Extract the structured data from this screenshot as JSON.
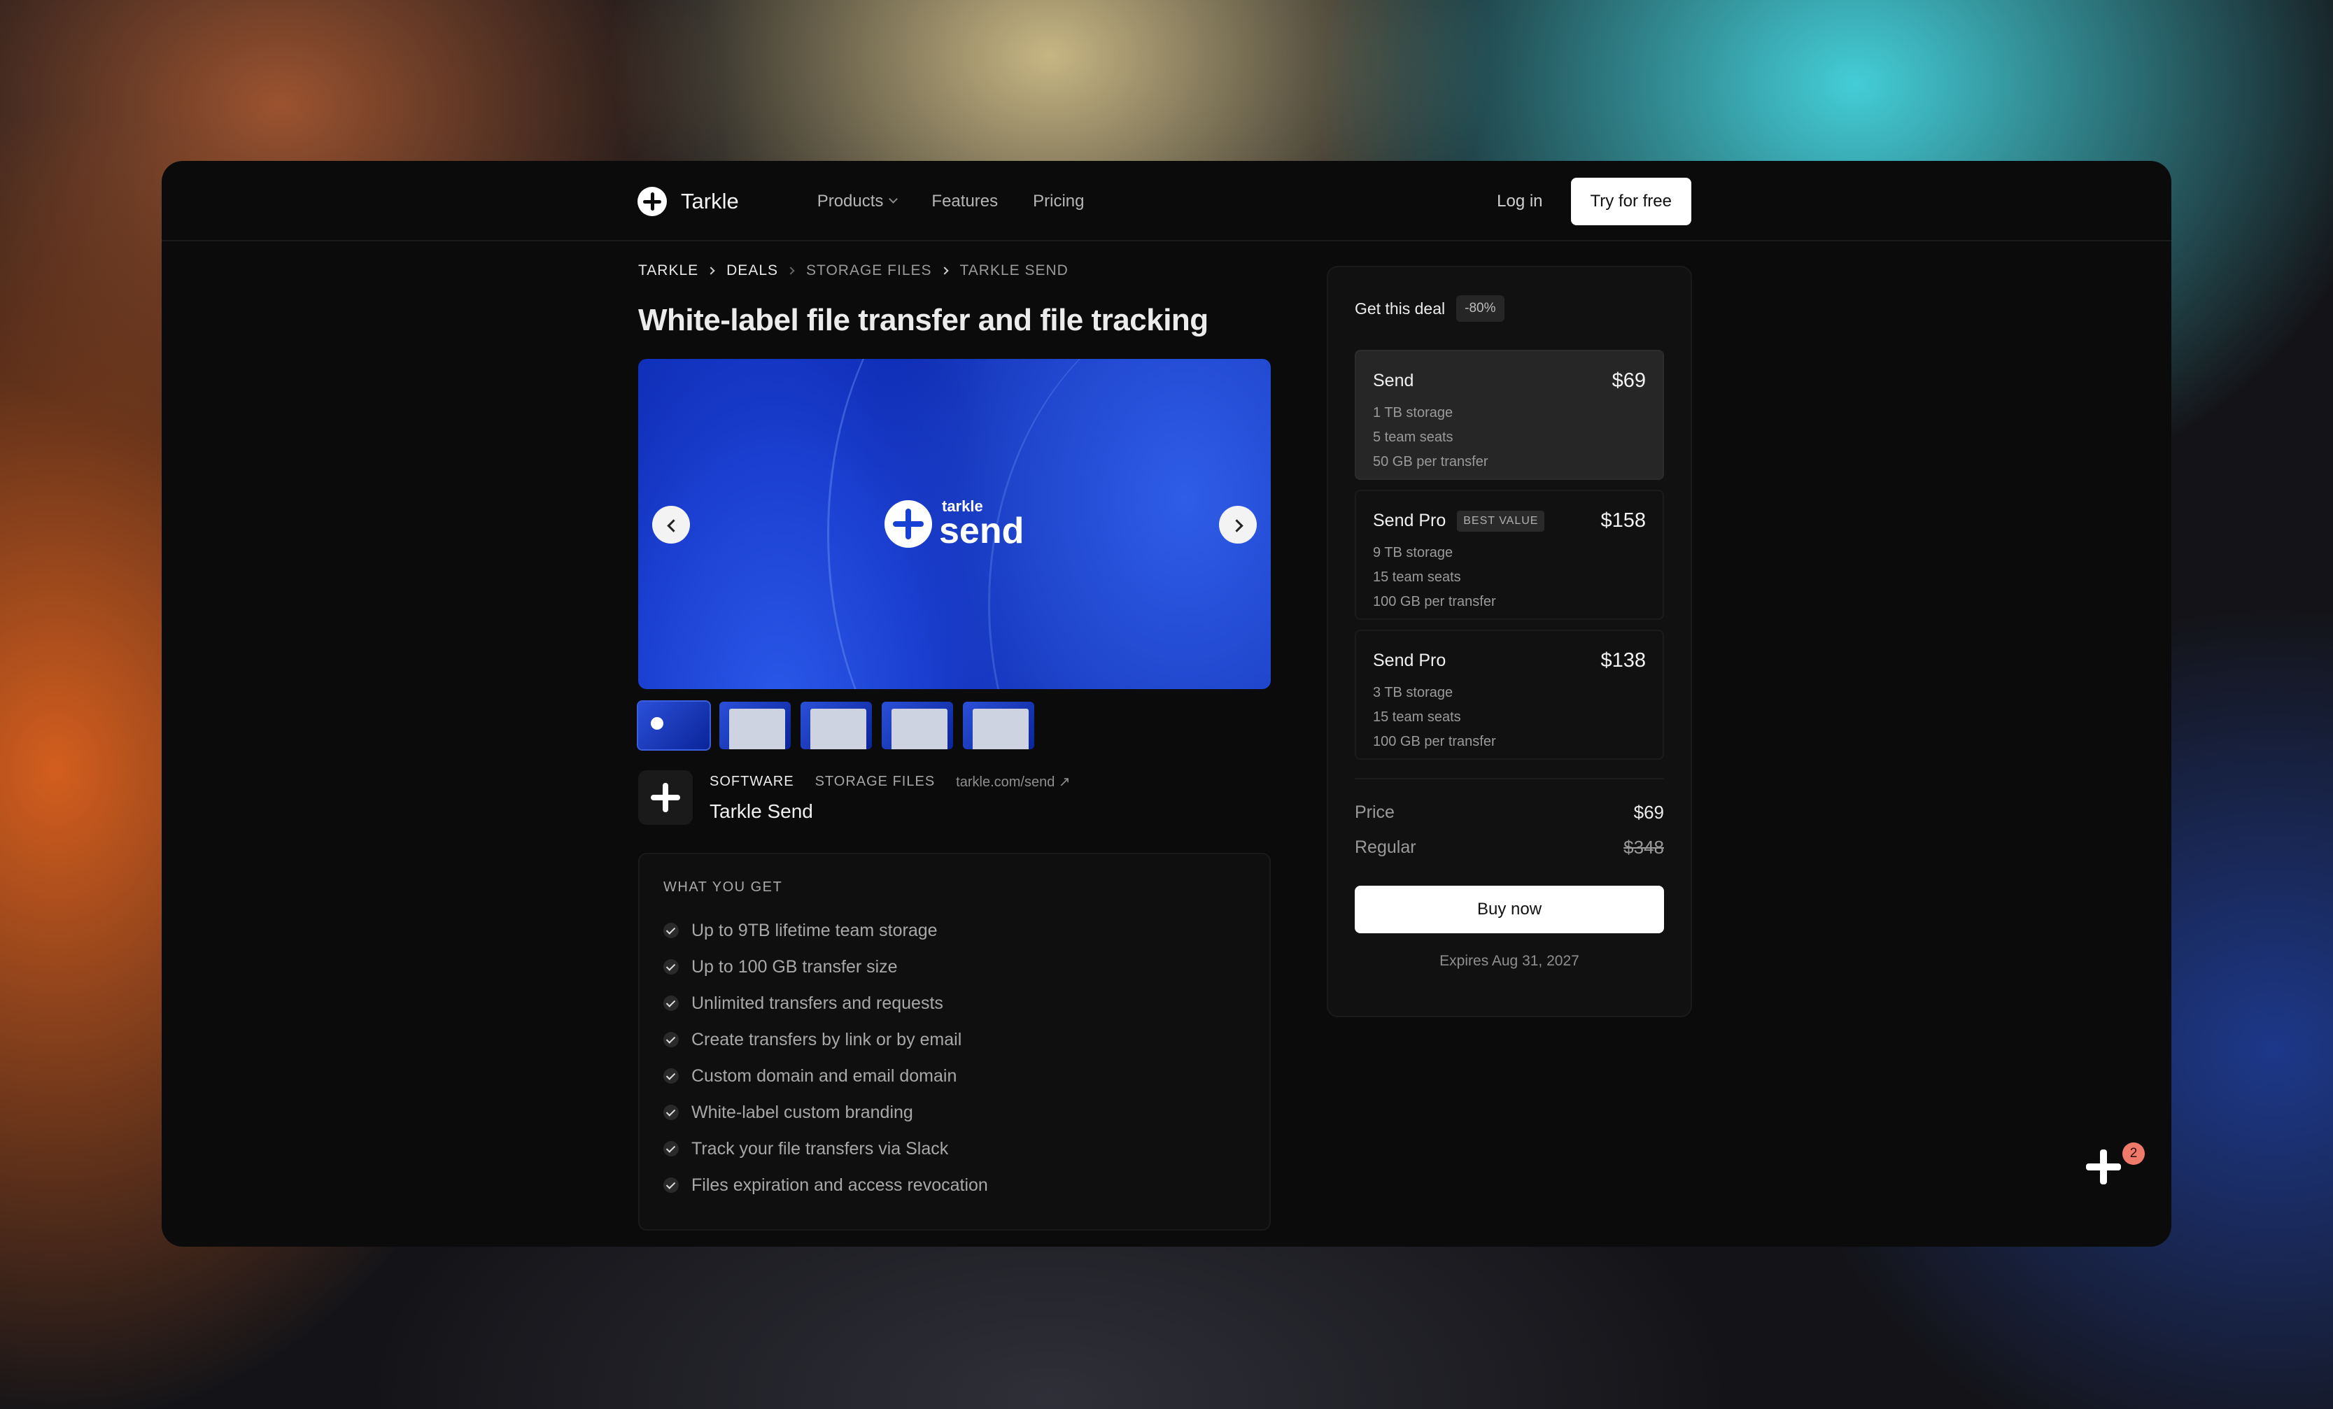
{
  "nav": {
    "brand": "Tarkle",
    "links": [
      {
        "label": "Products"
      },
      {
        "label": "Features"
      },
      {
        "label": "Pricing"
      }
    ],
    "login": "Log in",
    "cta": "Try for free"
  },
  "breadcrumb": [
    "TARKLE",
    "DEALS",
    "STORAGE FILES",
    "TARKLE SEND"
  ],
  "page": {
    "title": "White-label file transfer and file tracking"
  },
  "hero": {
    "brand_small": "tarkle",
    "brand_big": "send"
  },
  "product": {
    "tag1": "SOFTWARE",
    "tag2": "STORAGE FILES",
    "url": "tarkle.com/send ↗",
    "name": "Tarkle Send"
  },
  "what_you_get": {
    "title": "WHAT YOU GET",
    "items": [
      "Up to 9TB lifetime team storage",
      "Up to 100 GB transfer size",
      "Unlimited transfers and requests",
      "Create transfers by link or by email",
      "Custom domain and email domain",
      "White-label custom branding",
      "Track your file transfers via Slack",
      "Files expiration and access revocation"
    ]
  },
  "deal": {
    "title": "Get this deal",
    "discount": "-80%",
    "plans": [
      {
        "name": "Send",
        "badge": "",
        "price": "$69",
        "features": [
          "1 TB storage",
          "5 team seats",
          "50 GB per transfer"
        ]
      },
      {
        "name": "Send Pro",
        "badge": "BEST VALUE",
        "price": "$158",
        "features": [
          "9 TB storage",
          "15 team seats",
          "100 GB per transfer"
        ]
      },
      {
        "name": "Send Pro",
        "badge": "",
        "price": "$138",
        "features": [
          "3 TB storage",
          "15 team seats",
          "100 GB per transfer"
        ]
      }
    ],
    "price_label": "Price",
    "price": "$69",
    "regular_label": "Regular",
    "regular": "$348",
    "buy": "Buy now",
    "expires": "Expires Aug 31, 2027"
  },
  "fab": {
    "badge": "2"
  }
}
